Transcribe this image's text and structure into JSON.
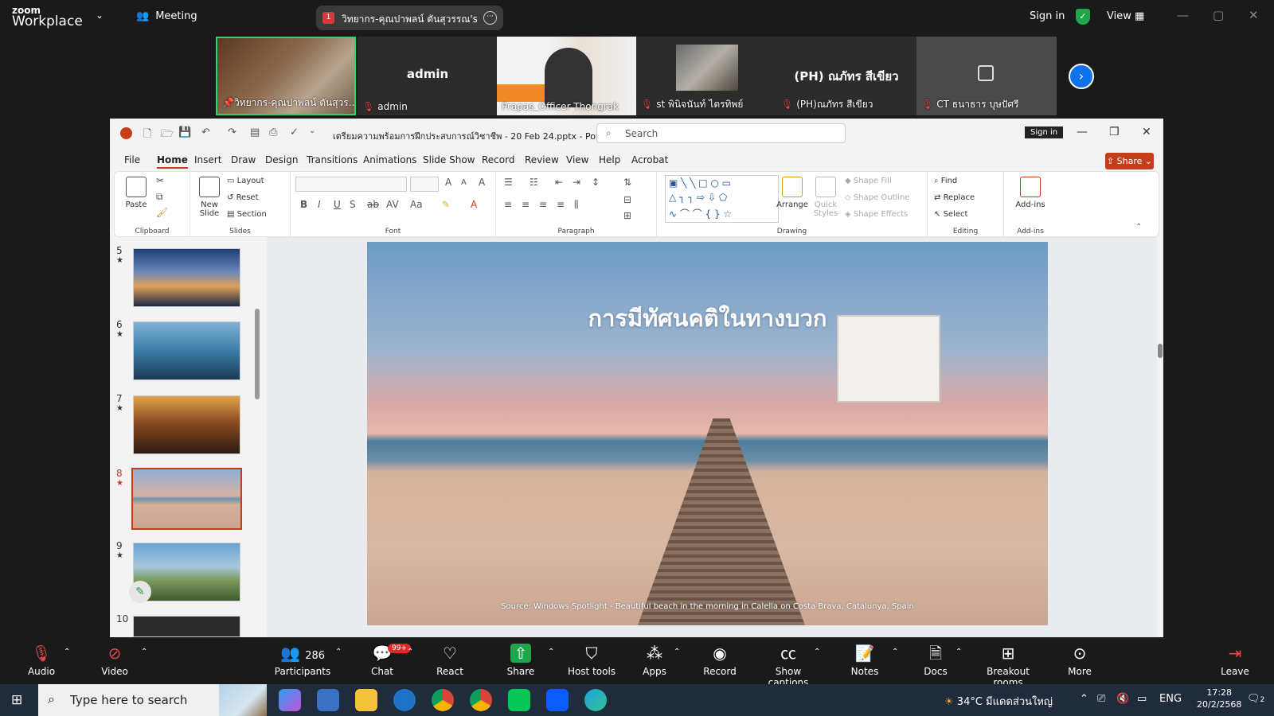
{
  "zoom": {
    "logo_top": "zoom",
    "logo_bottom": "Workplace",
    "meeting_label": "Meeting",
    "share_badge": "1",
    "share_pill": "วิทยากร-คุณปาพลน์ ตันสุวรรณ's scre",
    "sign_in": "Sign in",
    "view": "View"
  },
  "gallery": [
    {
      "name": "วิทยากร-คุณปาพลน์ ตันสุวร...",
      "big": "",
      "pinned": true
    },
    {
      "name": "admin",
      "big": "admin",
      "muted": true
    },
    {
      "name": "Prapas_Officer Thongrak",
      "big": ""
    },
    {
      "name": "st พินิจนันท์ ไตรทิพย์",
      "big": "",
      "muted": true
    },
    {
      "name": "(PH)ณภัทร สีเขียว",
      "big": "(PH) ณภัทร สีเขียว",
      "muted": true
    },
    {
      "name": "CT ธนาธาร บุษปัศรี",
      "big": "",
      "muted": true
    }
  ],
  "ppt": {
    "doc_title": "เตรียมความพร้อมการฝึกประสบการณ์วิชาชีพ - 20 Feb 24.pptx - PowerP...",
    "search_placeholder": "Search",
    "sign_in": "Sign in",
    "share": "Share",
    "tabs": [
      "File",
      "Home",
      "Insert",
      "Draw",
      "Design",
      "Transitions",
      "Animations",
      "Slide Show",
      "Record",
      "Review",
      "View",
      "Help",
      "Acrobat"
    ],
    "groups": {
      "clipboard": "Clipboard",
      "slides": "Slides",
      "font": "Font",
      "paragraph": "Paragraph",
      "drawing": "Drawing",
      "editing": "Editing",
      "addins": "Add-ins"
    },
    "buttons": {
      "paste": "Paste",
      "new_slide": "New Slide",
      "layout": "Layout",
      "reset": "Reset",
      "section": "Section",
      "arrange": "Arrange",
      "quick_styles": "Quick Styles",
      "shape_fill": "Shape Fill",
      "shape_outline": "Shape Outline",
      "shape_effects": "Shape Effects",
      "find": "Find",
      "replace": "Replace",
      "select": "Select",
      "addins": "Add-ins"
    },
    "thumb_numbers": [
      "5",
      "6",
      "7",
      "8",
      "9",
      "10"
    ],
    "slide_title": "การมีทัศนคติในทางบวก",
    "slide_source": "Source: Windows Spotlight - Beautiful beach in the morning in Calella on Costa Brava, Catalunya, Spain"
  },
  "toolbar": {
    "audio": "Audio",
    "video": "Video",
    "participants": "Participants",
    "participants_count": "286",
    "chat": "Chat",
    "chat_badge": "99+",
    "react": "React",
    "share": "Share",
    "host_tools": "Host tools",
    "apps": "Apps",
    "record": "Record",
    "show_captions": "Show captions",
    "notes": "Notes",
    "docs": "Docs",
    "breakout": "Breakout rooms",
    "more": "More",
    "leave": "Leave"
  },
  "taskbar": {
    "search_placeholder": "Type here to search",
    "weather": "34°C มีแดดส่วนใหญ่",
    "lang": "ENG",
    "time": "17:28",
    "date": "20/2/2568",
    "notif": "2"
  }
}
